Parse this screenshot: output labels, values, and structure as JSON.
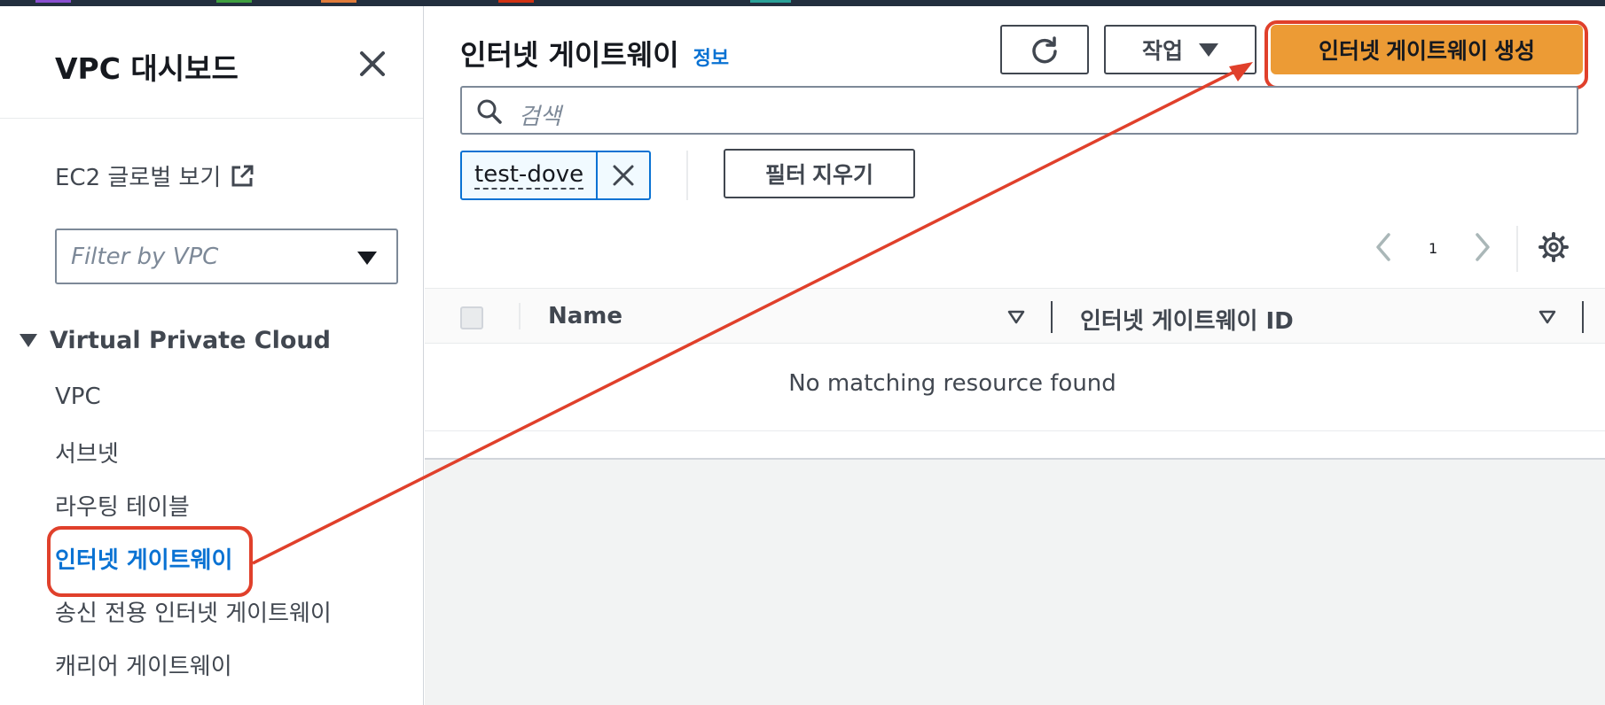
{
  "colors": {
    "accent": "#0972d3",
    "primary_button": "#ec9b35",
    "annotation": "#e0402b"
  },
  "sidebar": {
    "title": "VPC 대시보드",
    "ec2_link": "EC2 글로벌 보기",
    "filter_placeholder": "Filter by VPC",
    "section_title": "Virtual Private Cloud",
    "items": [
      {
        "label": "VPC"
      },
      {
        "label": "서브넷"
      },
      {
        "label": "라우팅 테이블"
      },
      {
        "label": "인터넷 게이트웨이"
      },
      {
        "label": "송신 전용 인터넷 게이트웨이"
      },
      {
        "label": "캐리어 게이트웨이"
      }
    ]
  },
  "main": {
    "title": "인터넷 게이트웨이",
    "info_link": "정보",
    "actions_label": "작업",
    "create_label": "인터넷 게이트웨이 생성",
    "search_placeholder": "검색",
    "filter_token": "test-dove",
    "clear_filters_label": "필터 지우기",
    "page_number": "1",
    "columns": [
      "Name",
      "인터넷 게이트웨이 ID"
    ],
    "empty_message": "No matching resource found"
  }
}
